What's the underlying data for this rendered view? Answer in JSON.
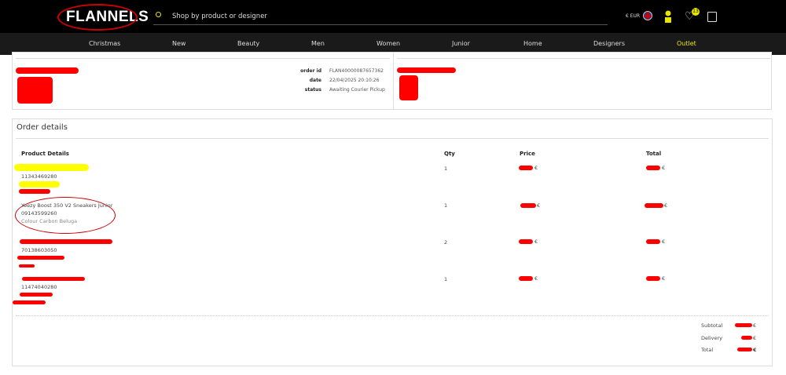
{
  "header": {
    "logo": "FLANNELS",
    "search_placeholder": "Shop by product or designer",
    "currency": "€ EUR",
    "wishlist_count": "13",
    "accent": "#e6e600"
  },
  "nav": [
    "Christmas",
    "New",
    "Beauty",
    "Men",
    "Women",
    "Junior",
    "Home",
    "Designers",
    "Outlet"
  ],
  "order": {
    "order_id_label": "order id",
    "order_id": "FLAN40000087657362",
    "date_label": "date",
    "date": "22/04/2025 20:10:26",
    "status_label": "status",
    "status": "Awaiting Courier Pickup"
  },
  "details": {
    "title": "Order details",
    "columns": [
      "Product Details",
      "Qty",
      "Price",
      "Total"
    ],
    "items": [
      {
        "name": "",
        "code": "11343469280",
        "colour": "",
        "qty": "1",
        "price": "€",
        "total": "€"
      },
      {
        "name": "Yeezy Boost 350 V2 Sneakers Junior",
        "code": "09143599260",
        "colour": "Colour Carbon Beluga",
        "qty": "1",
        "price": "€",
        "total": "€"
      },
      {
        "name": "",
        "code": "70138603050",
        "colour": "",
        "qty": "2",
        "price": "€",
        "total": "€"
      },
      {
        "name": "",
        "code": "11474040280",
        "colour": "",
        "qty": "1",
        "price": "€",
        "total": "€"
      }
    ],
    "summary": [
      {
        "label": "Subtotal",
        "value": "€"
      },
      {
        "label": "Delivery",
        "value": "€"
      },
      {
        "label": "Total",
        "value": "€"
      }
    ]
  }
}
